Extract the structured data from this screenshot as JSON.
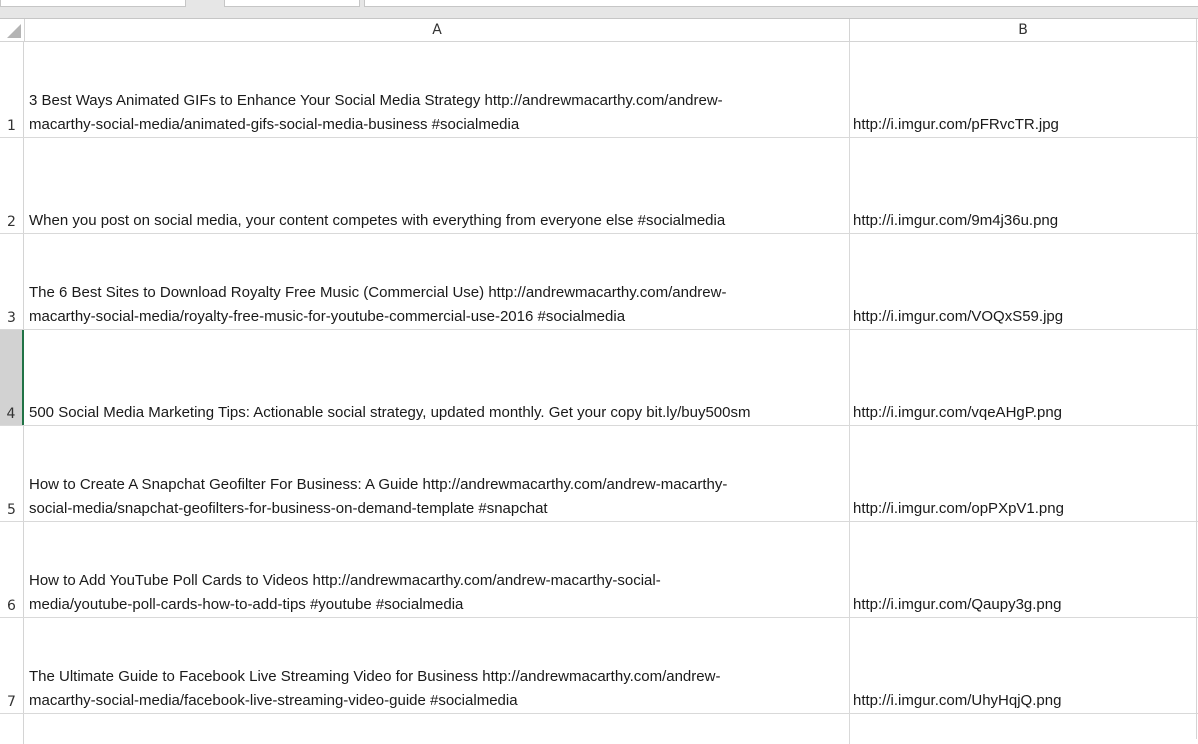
{
  "columns": {
    "a": "A",
    "b": "B"
  },
  "rows": [
    {
      "num": "1",
      "a": "3 Best Ways Animated GIFs to Enhance Your Social Media Strategy http://andrewmacarthy.com/andrew-\nmacarthy-social-media/animated-gifs-social-media-business #socialmedia",
      "b": "http://i.imgur.com/pFRvcTR.jpg"
    },
    {
      "num": "2",
      "a": "When you post on social media, your content competes with everything from everyone else #socialmedia",
      "b": "http://i.imgur.com/9m4j36u.png"
    },
    {
      "num": "3",
      "a": "The 6 Best Sites to Download Royalty Free Music (Commercial Use) http://andrewmacarthy.com/andrew-\nmacarthy-social-media/royalty-free-music-for-youtube-commercial-use-2016 #socialmedia",
      "b": "http://i.imgur.com/VOQxS59.jpg"
    },
    {
      "num": "4",
      "a": "500 Social Media Marketing Tips: Actionable social strategy, updated monthly. Get your copy bit.ly/buy500sm",
      "b": "http://i.imgur.com/vqeAHgP.png"
    },
    {
      "num": "5",
      "a": "How to Create A Snapchat Geofilter For Business: A Guide http://andrewmacarthy.com/andrew-macarthy-\nsocial-media/snapchat-geofilters-for-business-on-demand-template #snapchat",
      "b": "http://i.imgur.com/opPXpV1.png"
    },
    {
      "num": "6",
      "a": "How to Add YouTube Poll Cards to Videos http://andrewmacarthy.com/andrew-macarthy-social-\nmedia/youtube-poll-cards-how-to-add-tips #youtube #socialmedia",
      "b": "http://i.imgur.com/Qaupy3g.png"
    },
    {
      "num": "7",
      "a": "The Ultimate Guide to Facebook Live Streaming Video for Business http://andrewmacarthy.com/andrew-\nmacarthy-social-media/facebook-live-streaming-video-guide #socialmedia",
      "b": "http://i.imgur.com/UhyHqjQ.png"
    }
  ],
  "selected_row": "4",
  "colors": {
    "selection_accent": "#217346",
    "gridline": "#d9d9d9",
    "header_selected": "#d2d2d2"
  }
}
